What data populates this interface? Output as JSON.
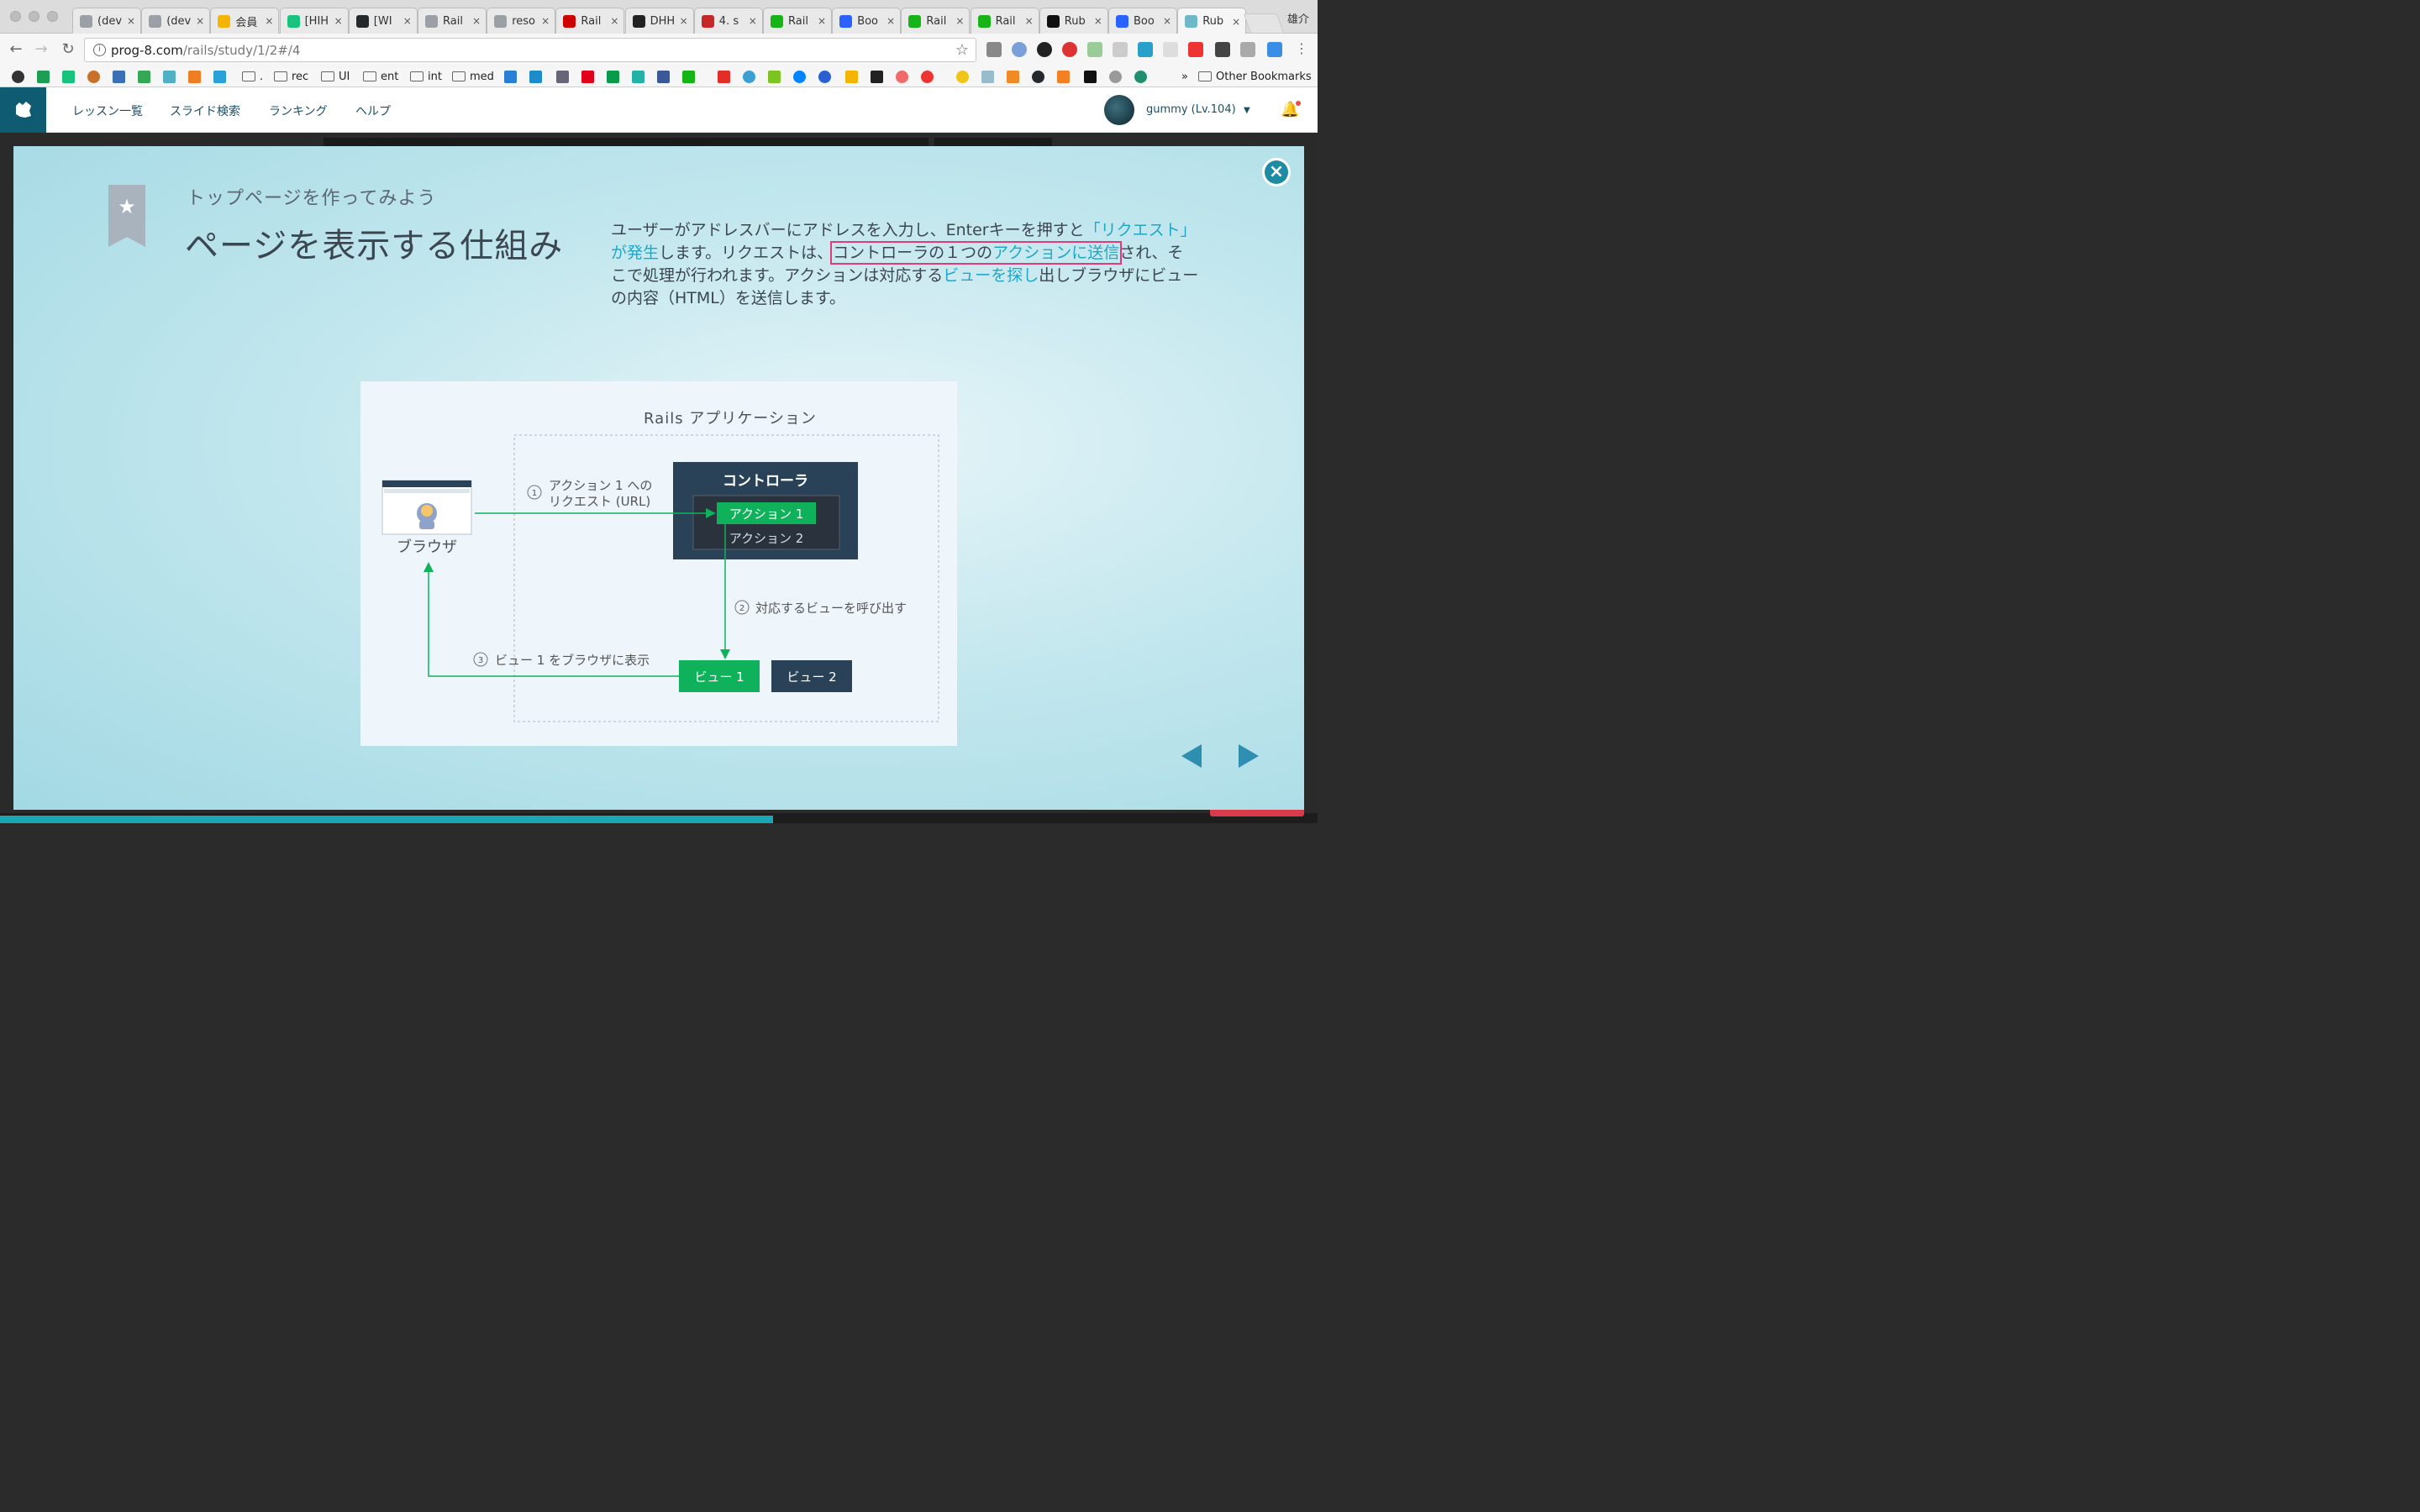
{
  "browser": {
    "tabs": [
      {
        "title": "(dev",
        "color": "#9aa0a6"
      },
      {
        "title": "(dev",
        "color": "#9aa0a6"
      },
      {
        "title": "会員",
        "color": "#f5b400"
      },
      {
        "title": "[HIH",
        "color": "#19c37d"
      },
      {
        "title": "[WI",
        "color": "#24292e"
      },
      {
        "title": "Rail",
        "color": "#9aa0a6"
      },
      {
        "title": "reso",
        "color": "#9aa0a6"
      },
      {
        "title": "Rail",
        "color": "#cc0000"
      },
      {
        "title": "DHH",
        "color": "#222222"
      },
      {
        "title": "4. s",
        "color": "#c62828"
      },
      {
        "title": "Rail",
        "color": "#17b417"
      },
      {
        "title": "Boo",
        "color": "#2962ff"
      },
      {
        "title": "Rail",
        "color": "#17b417"
      },
      {
        "title": "Rail",
        "color": "#17b417"
      },
      {
        "title": "Rub",
        "color": "#111111"
      },
      {
        "title": "Boo",
        "color": "#2962ff"
      },
      {
        "title": "Rub",
        "color": "#6fb8c9"
      }
    ],
    "profile_name": "雄介",
    "url_host": "prog-8.com",
    "url_path": "/rails/study/1/2#/4",
    "bookmarks": [
      {
        "label": "rec",
        "type": "folder"
      },
      {
        "label": "UI",
        "type": "folder"
      },
      {
        "label": "ent",
        "type": "folder"
      },
      {
        "label": "int",
        "type": "folder"
      },
      {
        "label": "med",
        "type": "folder"
      }
    ],
    "other_bookmarks": "Other Bookmarks",
    "overflow": "»"
  },
  "site": {
    "nav": [
      "レッスン一覧",
      "スライド検索",
      "ランキング",
      "ヘルプ"
    ],
    "username": "gummy (Lv.104)"
  },
  "slide": {
    "subtitle": "トップページを作ってみよう",
    "title": "ページを表示する仕組み",
    "desc": {
      "p1": "ユーザーがアドレスバーにアドレスを入力し、Enterキーを押すと",
      "h1": "「リクエスト」が発生",
      "p2": "します。リクエストは、",
      "b1": "コントローラの１つの",
      "h2": "アクションに送信",
      "p3": "さ",
      "p4": "れ、そこで処理が行われます。アクションは対応する",
      "h3": "ビューを探し",
      "p5": "出しブラウザにビューの内容（HTML）を送信します。"
    },
    "diagram": {
      "app_label": "Rails アプリケーション",
      "controller": "コントローラ",
      "action1": "アクション 1",
      "action2": "アクション 2",
      "browser_label": "ブラウザ",
      "step1_num": "1",
      "step1_line1": "アクション 1 への",
      "step1_line2": "リクエスト (URL)",
      "step2_num": "2",
      "step2": "対応するビューを呼び出す",
      "step3_num": "3",
      "step3": "ビュー 1 をブラウザに表示",
      "view1": "ビュー 1",
      "view2": "ビュー 2"
    }
  },
  "colors": {
    "green": "#0fb15a",
    "navy": "#2a4257",
    "accent": "#21a6c7",
    "highlight_box": "#e23b7b"
  }
}
